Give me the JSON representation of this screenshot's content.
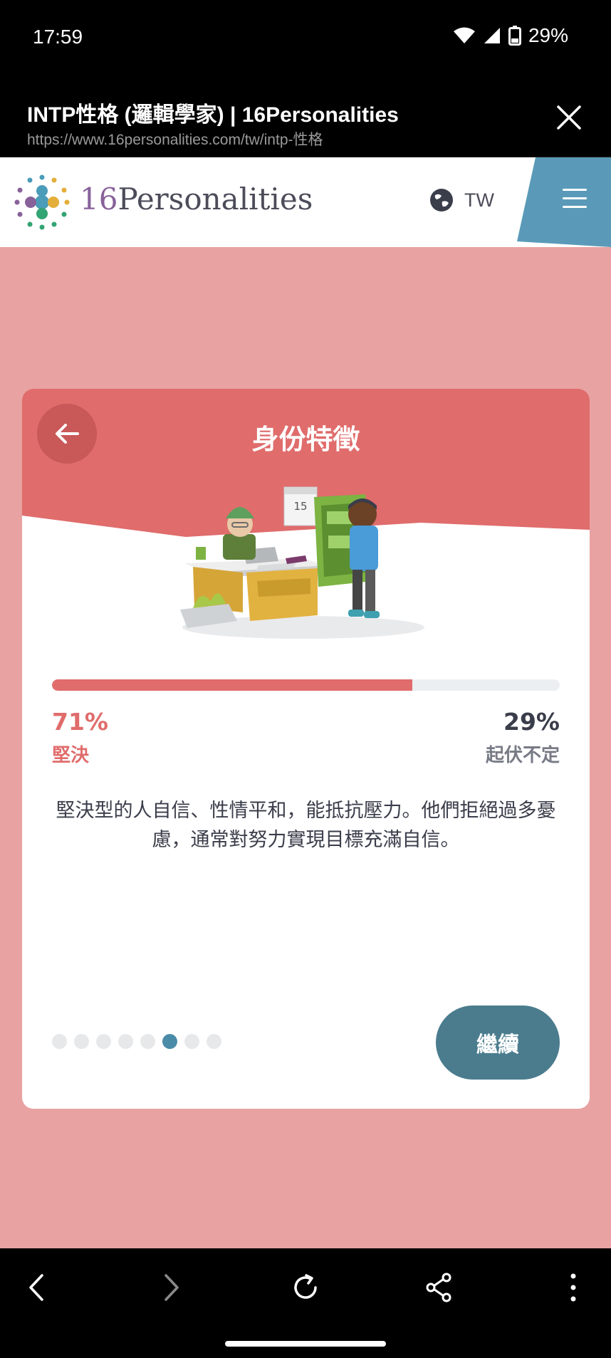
{
  "status_bar": {
    "time": "17:59",
    "battery": "29%"
  },
  "browser": {
    "title": "INTP性格 (邏輯學家) | 16Personalities",
    "url": "https://www.16personalities.com/tw/intp-性格"
  },
  "site": {
    "logo_number": "16",
    "logo_word": "Personalities",
    "language": "TW"
  },
  "card": {
    "title": "身份特徵",
    "progress_fraction": 0.71,
    "left": {
      "percent": "71%",
      "label": "堅決"
    },
    "right": {
      "percent": "29%",
      "label": "起伏不定"
    },
    "description": "堅決型的人自信、性情平和，能抵抗壓力。他們拒絕過多憂慮，通常對努力實現目標充滿自信。",
    "dots_total": 8,
    "dots_active_index": 5,
    "continue_label": "繼續"
  },
  "colors": {
    "page_bg": "#e9a2a2",
    "card_header": "#e06c6c",
    "accent_teal": "#4a7c8e",
    "dot_active": "#4a8ba8",
    "menu_tab": "#5a9ab8"
  }
}
